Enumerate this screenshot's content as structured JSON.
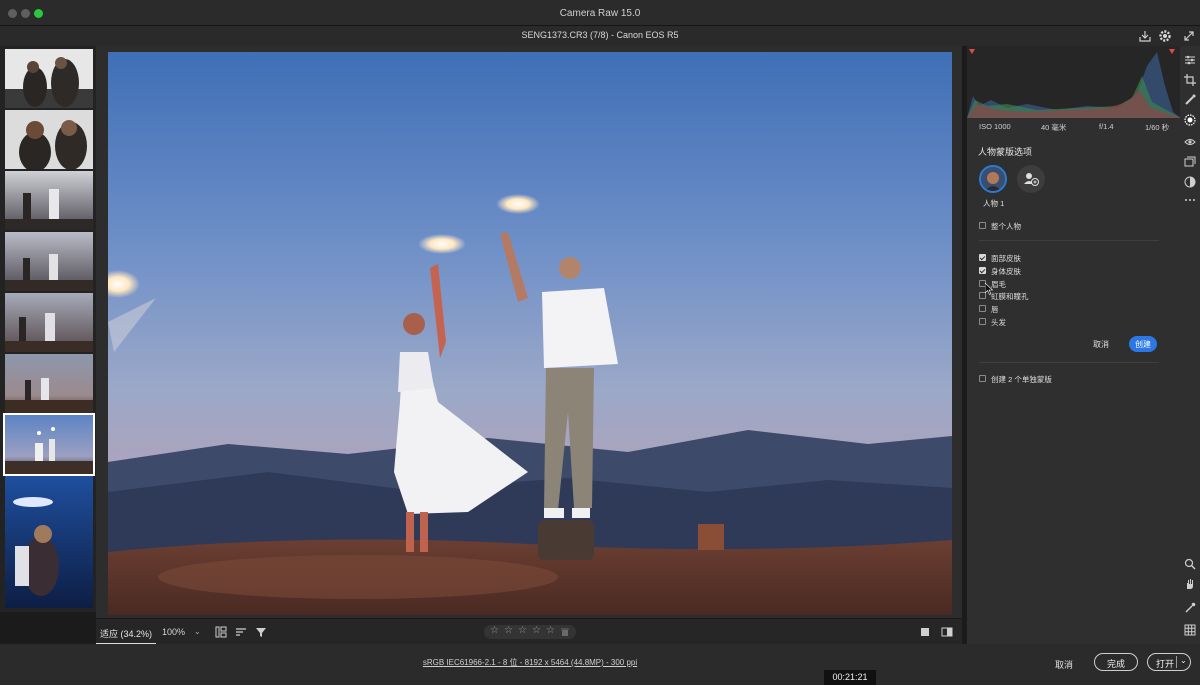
{
  "app": {
    "title": "Camera Raw 15.0"
  },
  "file": {
    "title": "SENG1373.CR3 (7/8) -  Canon EOS R5"
  },
  "header_icons": [
    "download-icon",
    "gear-icon",
    "expand-icon"
  ],
  "filmstrip": {
    "count": 8,
    "selected_index": 6
  },
  "bottom_toolbar": {
    "fit_label": "适应 (34.2%)",
    "zoom_label": "100%",
    "zoom_caret": "⌄",
    "rating_stars": [
      "☆",
      "☆",
      "☆",
      "☆",
      "☆"
    ]
  },
  "histogram": {
    "exif": {
      "iso": "ISO 1000",
      "focal": "40 毫米",
      "aperture": "f/1.4",
      "shutter": "1/60 秒"
    }
  },
  "mask_panel": {
    "title": "人物蒙版选项",
    "person_label": "人物 1",
    "options_top": [
      {
        "label": "整个人物",
        "checked": false
      }
    ],
    "options": [
      {
        "label": "面部皮肤",
        "checked": true
      },
      {
        "label": "身体皮肤",
        "checked": true
      },
      {
        "label": "眉毛",
        "checked": false
      },
      {
        "label": "虹膜和瞳孔",
        "checked": false
      },
      {
        "label": "唇",
        "checked": false
      },
      {
        "label": "头发",
        "checked": false
      }
    ],
    "cancel_label": "取消",
    "create_label": "创建",
    "separate_label": "创建 2 个单独蒙版"
  },
  "status": {
    "info": "sRGB IEC61966-2.1 - 8 位 - 8192 x 5464 (44.8MP) - 300 ppi",
    "cancel": "取消",
    "done": "完成",
    "open": "打开",
    "open_caret": "⌄"
  },
  "video": {
    "timecode": "00:21:21"
  }
}
